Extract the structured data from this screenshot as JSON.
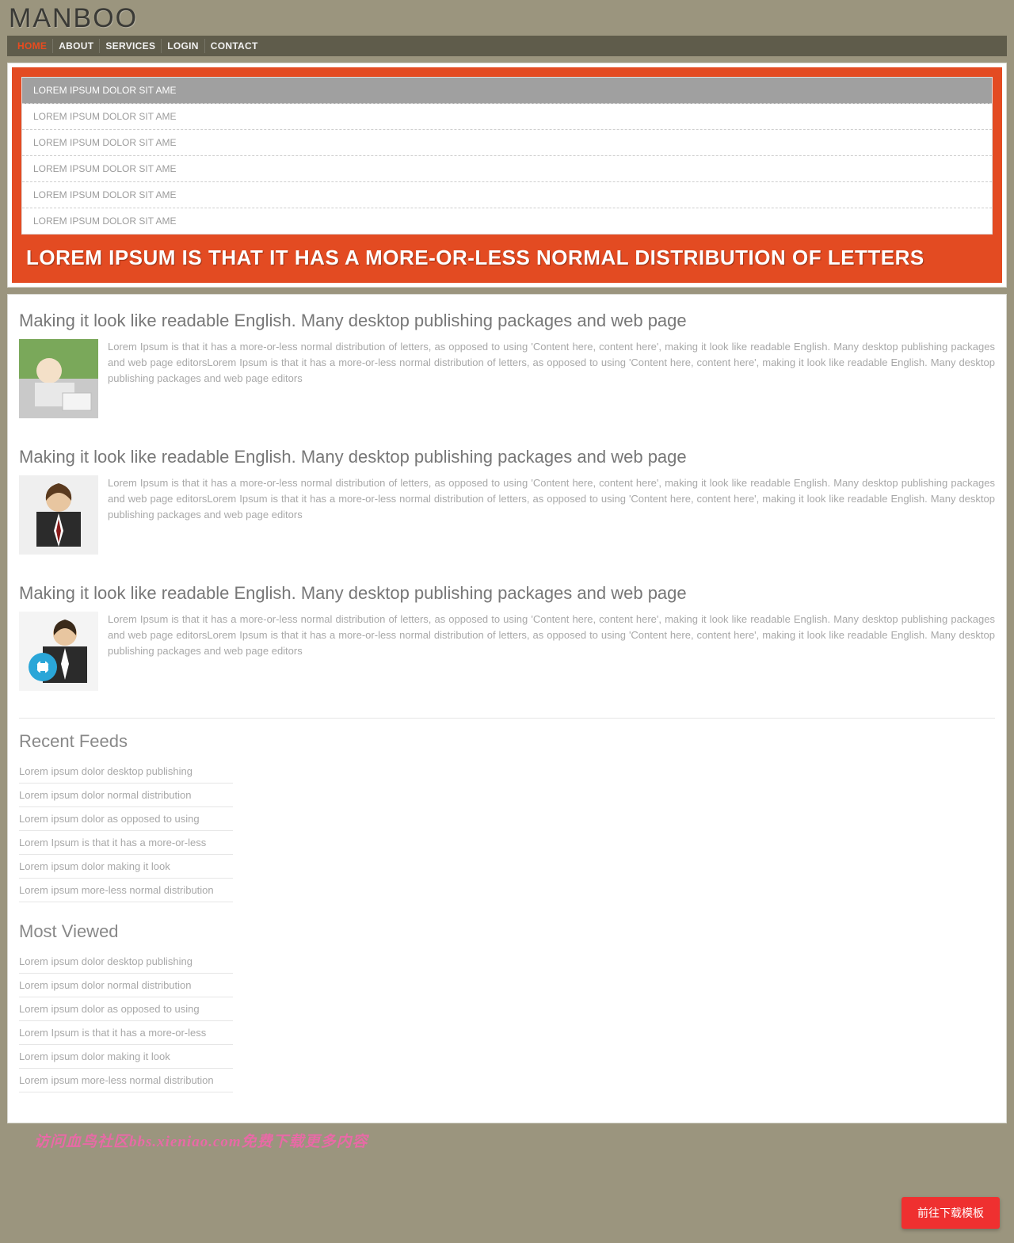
{
  "brand": "MANBOO",
  "nav": {
    "items": [
      {
        "label": "HOME",
        "active": true
      },
      {
        "label": "ABOUT",
        "active": false
      },
      {
        "label": "SERVICES",
        "active": false
      },
      {
        "label": "LOGIN",
        "active": false
      },
      {
        "label": "CONTACT",
        "active": false
      }
    ]
  },
  "hero": {
    "title": "LOREM IPSUM IS THAT IT HAS A MORE-OR-LESS NORMAL DISTRIBUTION OF LETTERS",
    "tabs": [
      {
        "label": "LOREM IPSUM DOLOR SIT AME",
        "active": true
      },
      {
        "label": "LOREM IPSUM DOLOR SIT AME",
        "active": false
      },
      {
        "label": "LOREM IPSUM DOLOR SIT AME",
        "active": false
      },
      {
        "label": "LOREM IPSUM DOLOR SIT AME",
        "active": false
      },
      {
        "label": "LOREM IPSUM DOLOR SIT AME",
        "active": false
      },
      {
        "label": "LOREM IPSUM DOLOR SIT AME",
        "active": false
      }
    ]
  },
  "articles": [
    {
      "heading": "Making it look like readable English. Many desktop publishing packages and web page",
      "body": "Lorem Ipsum is that it has a more-or-less normal distribution of letters, as opposed to using 'Content here, content here', making it look like readable English. Many desktop publishing packages and web page editorsLorem Ipsum is that it has a more-or-less normal distribution of letters, as opposed to using 'Content here, content here', making it look like readable English. Many desktop publishing packages and web page editors",
      "thumb": "photo-woman-laptop"
    },
    {
      "heading": "Making it look like readable English. Many desktop publishing packages and web page",
      "body": "Lorem Ipsum is that it has a more-or-less normal distribution of letters, as opposed to using 'Content here, content here', making it look like readable English. Many desktop publishing packages and web page editorsLorem Ipsum is that it has a more-or-less normal distribution of letters, as opposed to using 'Content here, content here', making it look like readable English. Many desktop publishing packages and web page editors",
      "thumb": "photo-man-suit"
    },
    {
      "heading": "Making it look like readable English. Many desktop publishing packages and web page",
      "body": "Lorem Ipsum is that it has a more-or-less normal distribution of letters, as opposed to using 'Content here, content here', making it look like readable English. Many desktop publishing packages and web page editorsLorem Ipsum is that it has a more-or-less normal distribution of letters, as opposed to using 'Content here, content here', making it look like readable English. Many desktop publishing packages and web page editors",
      "thumb": "photo-man-gear"
    }
  ],
  "recent_feeds": {
    "title": "Recent Feeds",
    "items": [
      "Lorem ipsum dolor desktop publishing",
      "Lorem ipsum dolor normal distribution",
      "Lorem ipsum dolor as opposed to using",
      "Lorem Ipsum is that it has a more-or-less",
      "Lorem ipsum dolor making it look",
      "Lorem ipsum more-less normal distribution"
    ]
  },
  "most_viewed": {
    "title": "Most Viewed",
    "items": [
      "Lorem ipsum dolor desktop publishing",
      "Lorem ipsum dolor normal distribution",
      "Lorem ipsum dolor as opposed to using",
      "Lorem Ipsum is that it has a more-or-less",
      "Lorem ipsum dolor making it look",
      "Lorem ipsum more-less normal distribution"
    ]
  },
  "footer_banner": "访问血鸟社区bbs.xieniao.com免费下载更多内容",
  "float_button": "前往下载模板"
}
